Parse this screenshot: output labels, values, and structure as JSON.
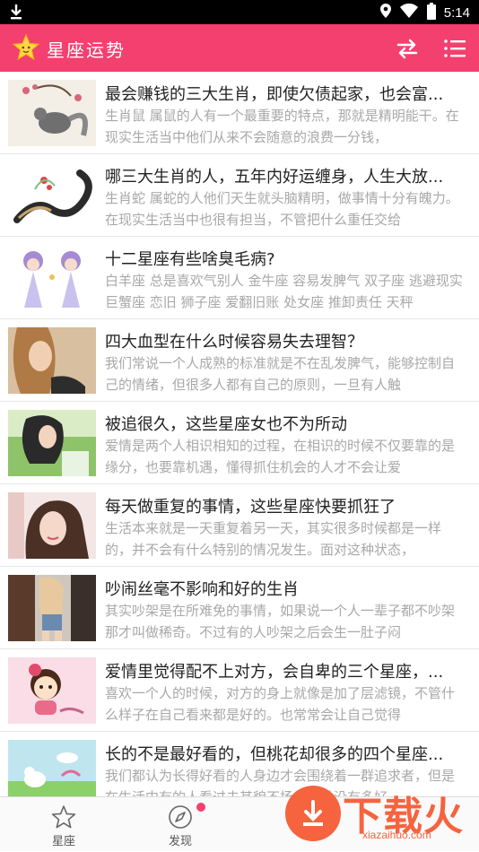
{
  "status_bar": {
    "time": "5:14"
  },
  "app_bar": {
    "title": "星座运势"
  },
  "articles": [
    {
      "title": "最会赚钱的三大生肖，即使欠债起家，也会富...",
      "summary": "生肖鼠 属鼠的人有一个最重要的特点，那就是精明能干。在现实生活当中他们从来不会随意的浪费一分钱，"
    },
    {
      "title": "哪三大生肖的人，五年内好运缠身，人生大放...",
      "summary": "生肖蛇 属蛇的人他们天生就头脑精明，做事情十分有魄力。在现实生活当中也很有担当，不管把什么重任交给"
    },
    {
      "title": "十二星座有些啥臭毛病?",
      "summary": "白羊座 总是喜欢气别人 金牛座 容易发脾气 双子座 逃避现实 巨蟹座 恋旧 狮子座 爱翻旧账 处女座 推卸责任 天秤"
    },
    {
      "title": "四大血型在什么时候容易失去理智？",
      "summary": "我们常说一个人成熟的标准就是不在乱发脾气，能够控制自己的情绪，但很多人都有自己的原则，一旦有人触"
    },
    {
      "title": "被追很久，这些星座女也不为所动",
      "summary": "爱情是两个人相识相知的过程，在相识的时候不仅要靠的是缘分，也要靠机遇，懂得抓住机会的人才不会让爱"
    },
    {
      "title": "每天做重复的事情，这些星座快要抓狂了",
      "summary": "生活本来就是一天重复着另一天，其实很多时候都是一样的，并不会有什么特别的情况发生。面对这种状态，"
    },
    {
      "title": "吵闹丝毫不影响和好的生肖",
      "summary": "其实吵架是在所难免的事情，如果说一个人一辈子都不吵架那才叫做稀奇。不过有的人吵架之后会生一肚子闷"
    },
    {
      "title": "爱情里觉得配不上对方，会自卑的三个星座，...",
      "summary": "喜欢一个人的时候，对方的身上就像是加了层滤镜，不管什么样子在自己看来都是好的。也常常会让自己觉得"
    },
    {
      "title": "长的不是最好看的，但桃花却很多的四个星座...",
      "summary": "我们都认为长得好看的人身边才会围绕着一群追求者，但是在生活中有的人看过去其貌不扬的，并没有多好"
    }
  ],
  "tabs": [
    {
      "label": "星座",
      "icon": "star-outline-icon"
    },
    {
      "label": "发现",
      "icon": "compass-icon"
    }
  ],
  "watermark": {
    "big": "下载火",
    "small": "xiazaihuo.com"
  },
  "colors": {
    "primary": "#f4406f",
    "watermark": "#f6633f"
  }
}
